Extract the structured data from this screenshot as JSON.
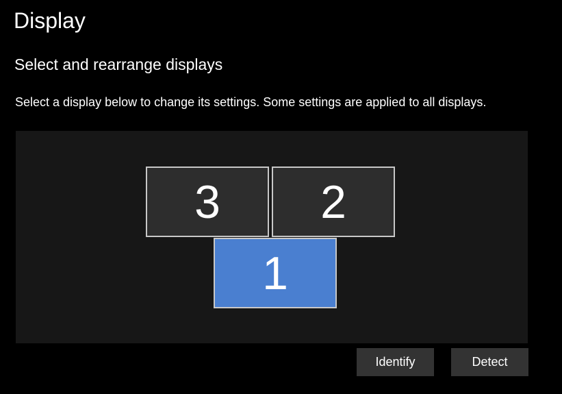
{
  "page": {
    "title": "Display",
    "section_title": "Select and rearrange displays",
    "description": "Select a display below to change its settings. Some settings are applied to all displays."
  },
  "monitors": [
    {
      "label": "3",
      "selected": false
    },
    {
      "label": "2",
      "selected": false
    },
    {
      "label": "1",
      "selected": true
    }
  ],
  "buttons": {
    "identify": "Identify",
    "detect": "Detect"
  },
  "colors": {
    "background": "#000000",
    "arrange_area": "#171717",
    "monitor": "#2d2d2d",
    "monitor_selected": "#4a7fd0",
    "monitor_border": "#c8c8c8",
    "button": "#333333"
  }
}
